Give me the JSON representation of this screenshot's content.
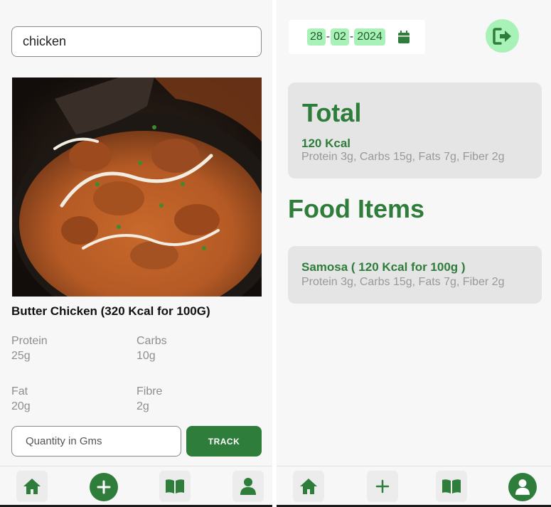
{
  "search": {
    "value": "chicken"
  },
  "food": {
    "title": "Butter Chicken (320 Kcal for 100G)",
    "nutrients": [
      {
        "label": "Protein",
        "value": "25g"
      },
      {
        "label": "Carbs",
        "value": "10g"
      },
      {
        "label": "Fat",
        "value": "20g"
      },
      {
        "label": "Fibre",
        "value": "2g"
      }
    ]
  },
  "quantity": {
    "placeholder": "Quantity in Gms"
  },
  "track_label": "TRACK",
  "date": {
    "day": "28",
    "month": "02",
    "year": "2024",
    "separator": "-"
  },
  "total": {
    "title": "Total",
    "kcal": "120 Kcal",
    "macros": "Protein 3g, Carbs 15g, Fats 7g, Fiber 2g"
  },
  "food_items": {
    "title": "Food Items",
    "items": [
      {
        "name": "Samosa ( 120 Kcal for 100g )",
        "macros": "Protein 3g, Carbs 15g, Fats 7g, Fiber 2g"
      }
    ]
  },
  "colors": {
    "accent": "#2e7d3a",
    "accent_light": "#a8f2b8",
    "card": "#e5e5e5",
    "muted": "#999999"
  },
  "icons": {
    "nav": [
      "home-icon",
      "add-icon",
      "book-icon",
      "user-icon"
    ],
    "calendar": "calendar-icon",
    "logout": "logout-icon"
  }
}
